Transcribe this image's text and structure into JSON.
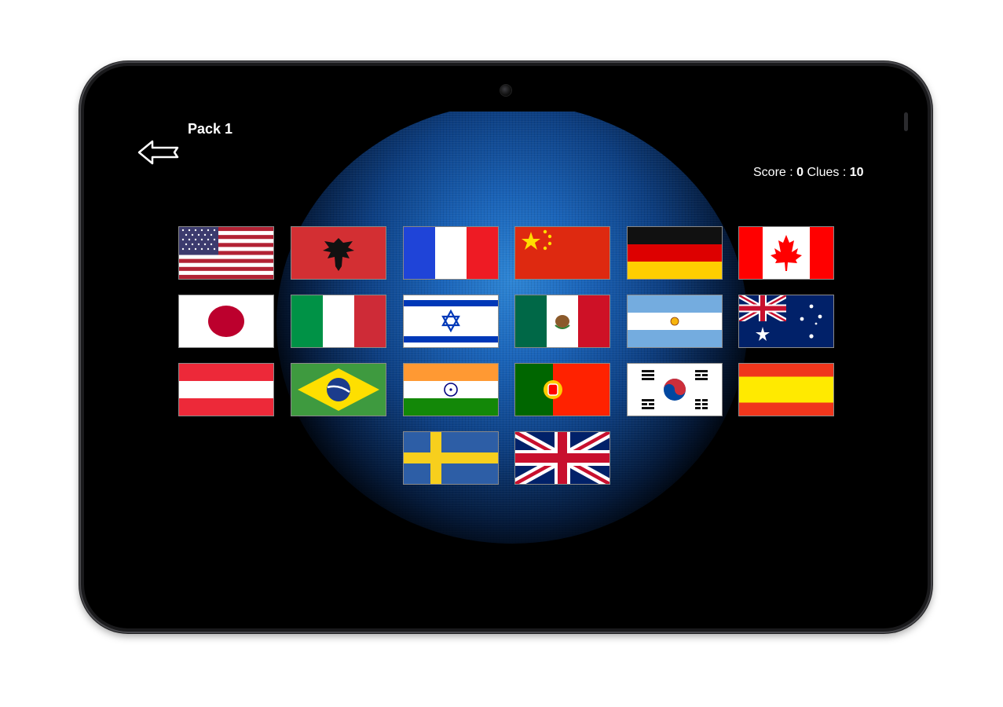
{
  "header": {
    "pack_title": "Pack 1",
    "score_label": "Score : ",
    "score_value": "0",
    "clues_label": " Clues : ",
    "clues_value": "10"
  },
  "icons": {
    "back": "back-arrow-icon"
  },
  "flags": [
    "usa",
    "albania",
    "france",
    "china",
    "germany",
    "canada",
    "japan",
    "italy",
    "israel",
    "mexico",
    "argentina",
    "australia",
    "austria",
    "brazil",
    "india",
    "portugal",
    "south-korea",
    "spain",
    "sweden",
    "united-kingdom"
  ],
  "colors": {
    "background": "#000000",
    "glow": "#2e86d6",
    "text": "#ffffff"
  }
}
